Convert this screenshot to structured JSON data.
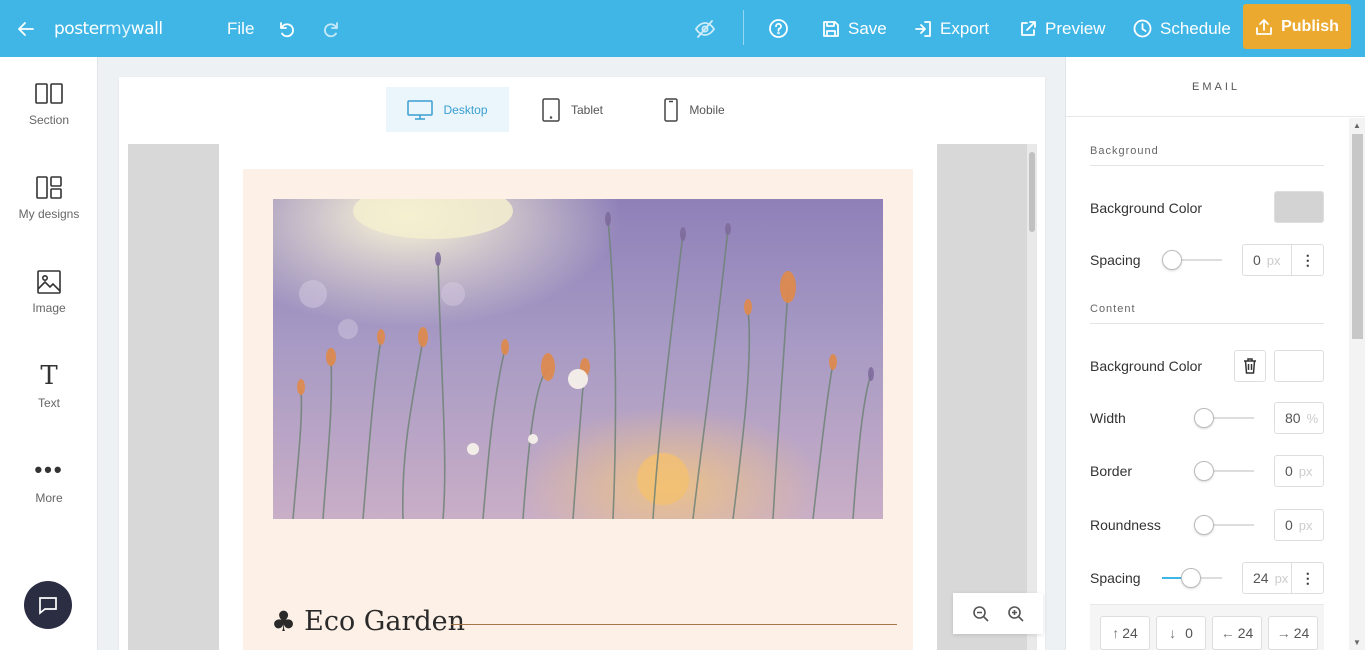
{
  "topbar": {
    "logo_left": "poster",
    "logo_mid": "my",
    "logo_right": "wall",
    "file": "File",
    "save": "Save",
    "export": "Export",
    "preview": "Preview",
    "schedule": "Schedule",
    "publish": "Publish"
  },
  "sidebar": {
    "items": [
      {
        "label": "Section",
        "icon": "section-icon"
      },
      {
        "label": "My designs",
        "icon": "my-designs-icon"
      },
      {
        "label": "Image",
        "icon": "image-icon"
      },
      {
        "label": "Text",
        "icon": "text-icon"
      },
      {
        "label": "More",
        "icon": "more-icon"
      }
    ]
  },
  "devices": {
    "desktop": "Desktop",
    "tablet": "Tablet",
    "mobile": "Mobile",
    "active": "Desktop"
  },
  "email_preview": {
    "heading": "Eco Garden",
    "heading_symbol": "♣"
  },
  "panel": {
    "title": "EMAIL",
    "background_section": "Background",
    "bg_color_label": "Background Color",
    "bg_color": "#d3d3d3",
    "bg_spacing_label": "Spacing",
    "bg_spacing_value": "0",
    "bg_spacing_unit": "px",
    "content_section": "Content",
    "content_bg_color_label": "Background Color",
    "content_bg_color": "#ffffff",
    "width_label": "Width",
    "width_value": "80",
    "width_unit": "%",
    "border_label": "Border",
    "border_value": "0",
    "border_unit": "px",
    "roundness_label": "Roundness",
    "roundness_value": "0",
    "roundness_unit": "px",
    "spacing_label": "Spacing",
    "spacing_value": "24",
    "spacing_unit": "px",
    "spacing_top": "24",
    "spacing_bottom": "0",
    "spacing_left": "24",
    "spacing_right": "24"
  },
  "colors": {
    "topbar": "#3fb6e6",
    "publish": "#ebaa2f",
    "content_bg": "#fdf0e6"
  }
}
